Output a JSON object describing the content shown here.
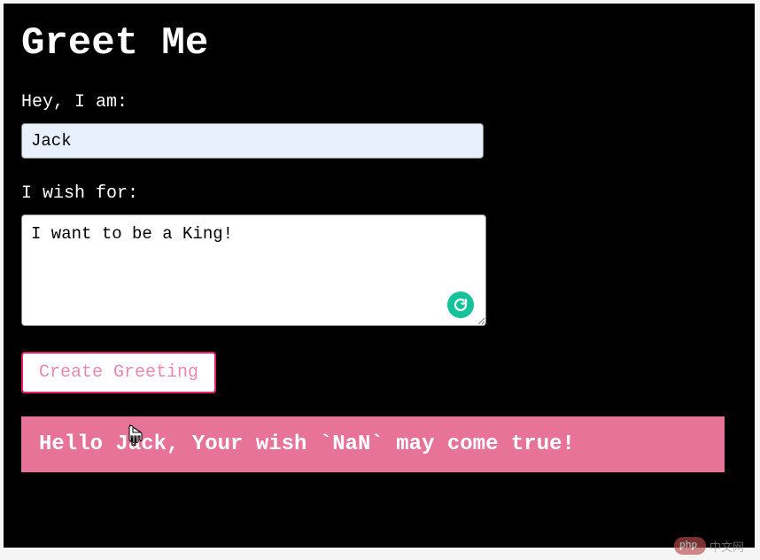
{
  "page": {
    "title": "Greet Me"
  },
  "form": {
    "name_label": "Hey, I am:",
    "name_value": "Jack",
    "wish_label": "I wish for:",
    "wish_value": "I want to be a King!",
    "submit_label": "Create Greeting"
  },
  "output": {
    "message": "Hello Jack, Your wish `NaN` may come true!"
  },
  "colors": {
    "background": "#000000",
    "accent_pink": "#e77399",
    "button_border": "#e91e63",
    "input_autofill": "#e8f0fe",
    "grammarly": "#15c39a"
  },
  "watermark": {
    "text": "中文网"
  }
}
